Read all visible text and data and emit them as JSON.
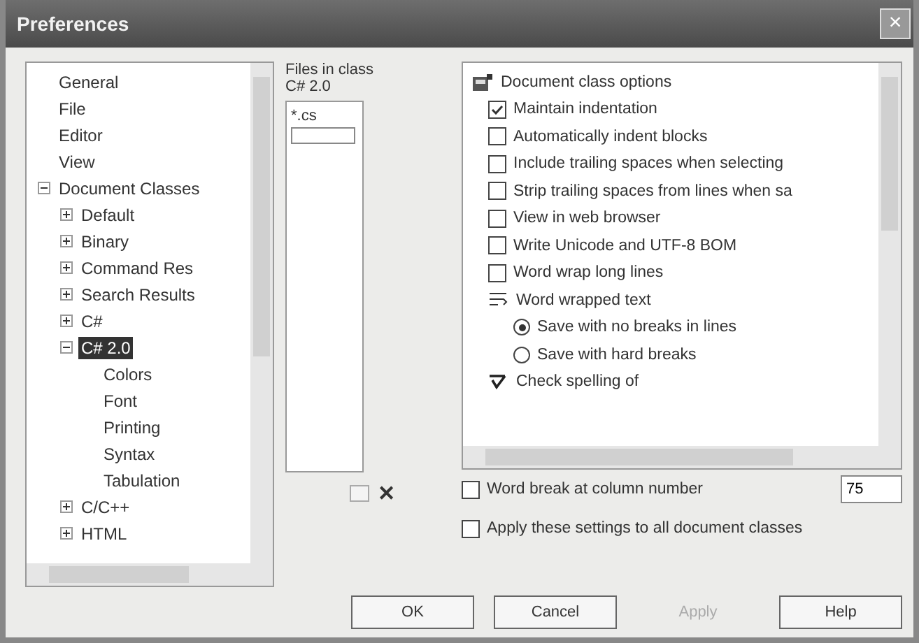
{
  "window": {
    "title": "Preferences",
    "close": "×"
  },
  "tree": [
    {
      "label": "General",
      "selected": false
    },
    {
      "label": "File",
      "selected": false
    },
    {
      "label": "Editor",
      "selected": false
    },
    {
      "label": "View",
      "selected": false
    },
    {
      "label": "Document Classes",
      "selected": false,
      "expanded": true,
      "children": [
        {
          "label": "Default",
          "selected": false,
          "expanded": false
        },
        {
          "label": "Binary",
          "selected": false,
          "expanded": false
        },
        {
          "label": "Command Res",
          "selected": false,
          "expanded": false
        },
        {
          "label": "Search Results",
          "selected": false,
          "expanded": false
        },
        {
          "label": "C#",
          "selected": false,
          "expanded": false
        },
        {
          "label": "C# 2.0",
          "selected": true,
          "expanded": true,
          "children": [
            {
              "label": "Colors",
              "selected": false
            },
            {
              "label": "Font",
              "selected": false
            },
            {
              "label": "Printing",
              "selected": false
            },
            {
              "label": "Syntax",
              "selected": false
            },
            {
              "label": "Tabulation",
              "selected": false
            }
          ]
        },
        {
          "label": "C/C++",
          "selected": false,
          "expanded": false
        },
        {
          "label": "HTML",
          "selected": false,
          "expanded": false
        }
      ]
    }
  ],
  "files": {
    "title": "Files in class",
    "class_name": "C# 2.0",
    "items": [
      "*.cs"
    ],
    "delete": "✕"
  },
  "options": [
    {
      "kind": "header",
      "label": "Document class options"
    },
    {
      "kind": "checkbox",
      "label": "Maintain indentation",
      "checked": true
    },
    {
      "kind": "checkbox",
      "label": "Automatically indent blocks",
      "checked": false
    },
    {
      "kind": "checkbox",
      "label": "Include trailing spaces when selecting",
      "checked": false
    },
    {
      "kind": "checkbox",
      "label": "Strip trailing spaces from lines when sa",
      "checked": false
    },
    {
      "kind": "checkbox",
      "label": "View in web browser",
      "checked": false
    },
    {
      "kind": "checkbox",
      "label": "Write Unicode and UTF-8 BOM",
      "checked": false
    },
    {
      "kind": "checkbox",
      "label": "Word wrap long lines",
      "checked": false
    },
    {
      "kind": "group",
      "label": "Word wrapped text"
    },
    {
      "kind": "radio",
      "label": "Save with no breaks in lines",
      "selected": true
    },
    {
      "kind": "radio",
      "label": "Save with hard breaks",
      "selected": false
    },
    {
      "kind": "spell",
      "label": "Check spelling of"
    }
  ],
  "word_break": {
    "label": "Word break at column number",
    "checked": false,
    "value": "75"
  },
  "apply_all": {
    "label": "Apply these settings to all document classes",
    "checked": false
  },
  "buttons": [
    {
      "label": "OK",
      "disabled": false
    },
    {
      "label": "Cancel",
      "disabled": false
    },
    {
      "label": "Apply",
      "disabled": true
    },
    {
      "label": "Help",
      "disabled": false
    }
  ]
}
